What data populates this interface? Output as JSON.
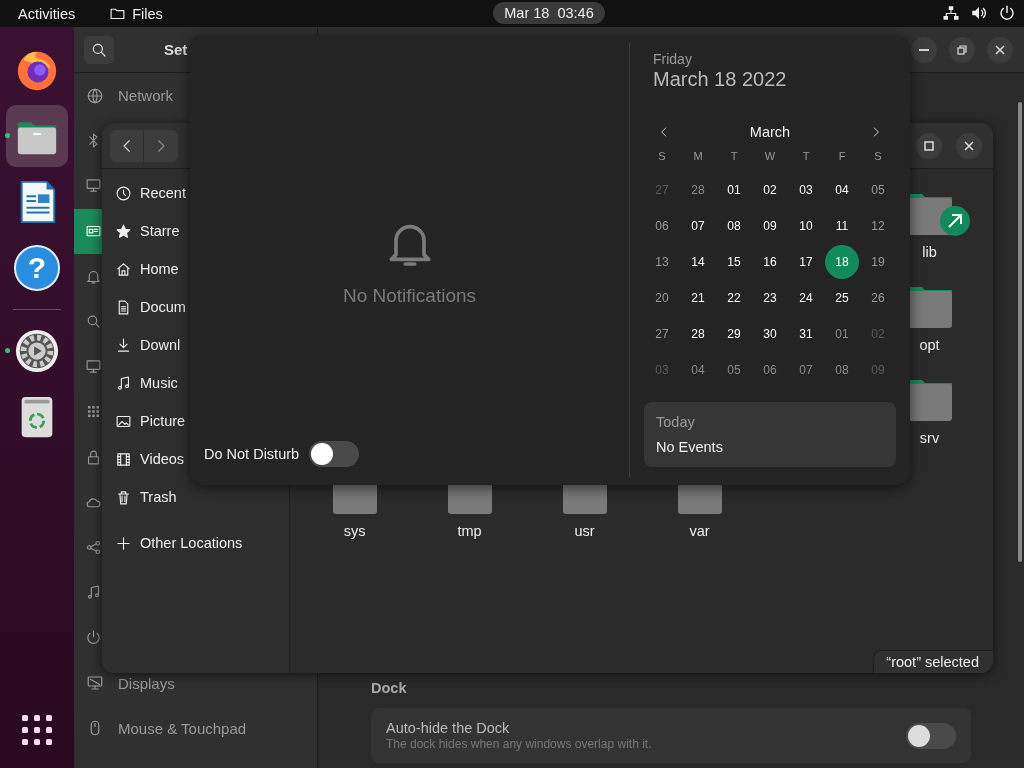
{
  "top_bar": {
    "activities": "Activities",
    "app_menu": "Files",
    "clock": "Mar 18  03:46"
  },
  "dock": {
    "apps": [
      {
        "kind": "firefox",
        "running": false,
        "focused": false
      },
      {
        "kind": "files",
        "running": true,
        "focused": true
      },
      {
        "kind": "writer",
        "running": false,
        "focused": false
      },
      {
        "kind": "help",
        "glyph": "?",
        "running": false,
        "focused": false
      },
      {
        "kind": "separator"
      },
      {
        "kind": "settings",
        "running": true,
        "focused": false
      },
      {
        "kind": "trash",
        "running": false,
        "focused": false
      }
    ]
  },
  "settings_window": {
    "title": "Set",
    "sidebar": [
      {
        "kind": "network",
        "label": "Network",
        "selected": false
      },
      {
        "kind": "bluetooth",
        "selected": false
      },
      {
        "kind": "background",
        "selected": false
      },
      {
        "kind": "appearance",
        "selected": true
      },
      {
        "kind": "notifications",
        "selected": false
      },
      {
        "kind": "search",
        "selected": false
      },
      {
        "kind": "multitasking",
        "selected": false
      },
      {
        "kind": "applications",
        "selected": false
      },
      {
        "kind": "privacy",
        "selected": false
      },
      {
        "kind": "online_accounts",
        "selected": false
      },
      {
        "kind": "sharing",
        "selected": false
      },
      {
        "kind": "sound",
        "selected": false
      },
      {
        "kind": "power",
        "selected": false
      },
      {
        "kind": "displays",
        "label": "Displays",
        "selected": false
      },
      {
        "kind": "mouse",
        "label": "Mouse & Touchpad",
        "selected": false
      }
    ],
    "section_title": "Dock",
    "settings": [
      {
        "label": "Auto-hide the Dock",
        "description": "The dock hides when any windows overlap with it.",
        "on": false
      }
    ]
  },
  "files_window": {
    "places": [
      {
        "kind": "recent",
        "label": "Recent"
      },
      {
        "kind": "starred",
        "label": "Starre"
      },
      {
        "kind": "home",
        "label": "Home"
      },
      {
        "kind": "documents",
        "label": "Docum"
      },
      {
        "kind": "downloads",
        "label": "Downl"
      },
      {
        "kind": "music",
        "label": "Music"
      },
      {
        "kind": "pictures",
        "label": "Picture"
      },
      {
        "kind": "videos",
        "label": "Videos"
      },
      {
        "kind": "trash",
        "label": "Trash"
      }
    ],
    "other_locations": "Other Locations",
    "folders": [
      {
        "name": "lib",
        "link": true
      },
      {
        "name": "opt",
        "link": false
      },
      {
        "name": "srv",
        "link": false
      },
      {
        "name": "sys",
        "link": false
      },
      {
        "name": "tmp",
        "link": false
      },
      {
        "name": "usr",
        "link": false
      },
      {
        "name": "var",
        "link": false
      }
    ],
    "status": "“root” selected"
  },
  "message_tray": {
    "empty_text": "No Notifications",
    "dnd": {
      "label": "Do Not Disturb",
      "on": false
    },
    "weekday": "Friday",
    "date": "March 18 2022",
    "month": "March",
    "weekdays": [
      "S",
      "M",
      "T",
      "W",
      "T",
      "F",
      "S"
    ],
    "days": [
      {
        "text": "27",
        "kind": "other_weekend",
        "selected": false
      },
      {
        "text": "28",
        "kind": "other",
        "selected": false
      },
      {
        "text": "01",
        "kind": "day",
        "selected": false
      },
      {
        "text": "02",
        "kind": "day",
        "selected": false
      },
      {
        "text": "03",
        "kind": "day",
        "selected": false
      },
      {
        "text": "04",
        "kind": "day",
        "selected": false
      },
      {
        "text": "05",
        "kind": "weekend",
        "selected": false
      },
      {
        "text": "06",
        "kind": "weekend",
        "selected": false
      },
      {
        "text": "07",
        "kind": "day",
        "selected": false
      },
      {
        "text": "08",
        "kind": "day",
        "selected": false
      },
      {
        "text": "09",
        "kind": "day",
        "selected": false
      },
      {
        "text": "10",
        "kind": "day",
        "selected": false
      },
      {
        "text": "11",
        "kind": "day",
        "selected": false
      },
      {
        "text": "12",
        "kind": "weekend",
        "selected": false
      },
      {
        "text": "13",
        "kind": "weekend",
        "selected": false
      },
      {
        "text": "14",
        "kind": "day",
        "selected": false
      },
      {
        "text": "15",
        "kind": "day",
        "selected": false
      },
      {
        "text": "16",
        "kind": "day",
        "selected": false
      },
      {
        "text": "17",
        "kind": "day",
        "selected": false
      },
      {
        "text": "18",
        "kind": "day",
        "selected": true
      },
      {
        "text": "19",
        "kind": "weekend",
        "selected": false
      },
      {
        "text": "20",
        "kind": "weekend",
        "selected": false
      },
      {
        "text": "21",
        "kind": "day",
        "selected": false
      },
      {
        "text": "22",
        "kind": "day",
        "selected": false
      },
      {
        "text": "23",
        "kind": "day",
        "selected": false
      },
      {
        "text": "24",
        "kind": "day",
        "selected": false
      },
      {
        "text": "25",
        "kind": "day",
        "selected": false
      },
      {
        "text": "26",
        "kind": "weekend",
        "selected": false
      },
      {
        "text": "27",
        "kind": "weekend",
        "selected": false
      },
      {
        "text": "28",
        "kind": "day",
        "selected": false
      },
      {
        "text": "29",
        "kind": "day",
        "selected": false
      },
      {
        "text": "30",
        "kind": "day",
        "selected": false
      },
      {
        "text": "31",
        "kind": "day",
        "selected": false
      },
      {
        "text": "01",
        "kind": "other",
        "selected": false
      },
      {
        "text": "02",
        "kind": "other_weekend",
        "selected": false
      },
      {
        "text": "03",
        "kind": "other_weekend",
        "selected": false
      },
      {
        "text": "04",
        "kind": "other",
        "selected": false
      },
      {
        "text": "05",
        "kind": "other",
        "selected": false
      },
      {
        "text": "06",
        "kind": "other",
        "selected": false
      },
      {
        "text": "07",
        "kind": "other",
        "selected": false
      },
      {
        "text": "08",
        "kind": "other",
        "selected": false
      },
      {
        "text": "09",
        "kind": "other_weekend",
        "selected": false
      }
    ],
    "events": {
      "title": "Today",
      "text": "No Events"
    }
  }
}
